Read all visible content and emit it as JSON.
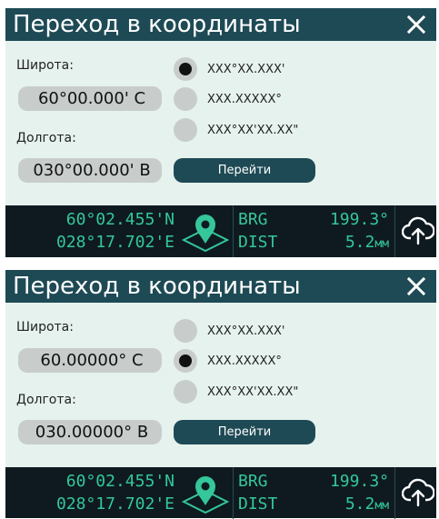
{
  "panels": [
    {
      "title": "Переход в координаты",
      "close_label": "X",
      "latitude_label": "Широта:",
      "latitude_value": "60°00.000' С",
      "longitude_label": "Долгота:",
      "longitude_value": "030°00.000' В",
      "format_options": [
        {
          "label": "XXX°XX.XXX'",
          "selected": true
        },
        {
          "label": "XXX.XXXXX°",
          "selected": false
        },
        {
          "label": "XXX°XX'XX.XX\"",
          "selected": false
        }
      ],
      "go_label": "Перейти",
      "status": {
        "lat": "60°02.455'N",
        "lon": "028°17.702'E",
        "brg_label": "BRG",
        "brg_value": "199.3°",
        "dist_label": "DIST",
        "dist_value": "5.2",
        "dist_unit": "мм"
      }
    },
    {
      "title": "Переход в координаты",
      "close_label": "X",
      "latitude_label": "Широта:",
      "latitude_value": "60.00000° С",
      "longitude_label": "Долгота:",
      "longitude_value": "030.00000° В",
      "format_options": [
        {
          "label": "XXX°XX.XXX'",
          "selected": false
        },
        {
          "label": "XXX.XXXXX°",
          "selected": true
        },
        {
          "label": "XXX°XX'XX.XX\"",
          "selected": false
        }
      ],
      "go_label": "Перейти",
      "status": {
        "lat": "60°02.455'N",
        "lon": "028°17.702'E",
        "brg_label": "BRG",
        "brg_value": "199.3°",
        "dist_label": "DIST",
        "dist_value": "5.2",
        "dist_unit": "мм"
      }
    }
  ],
  "colors": {
    "header": "#1e4a55",
    "panel_bg": "#e6f2ee",
    "field_bg": "#c8cdcc",
    "status_bg": "#0e1a20",
    "status_text": "#35c69a"
  },
  "icons": {
    "close": "close-icon",
    "navigate": "location-pin-icon",
    "cloud": "cloud-upload-icon"
  }
}
